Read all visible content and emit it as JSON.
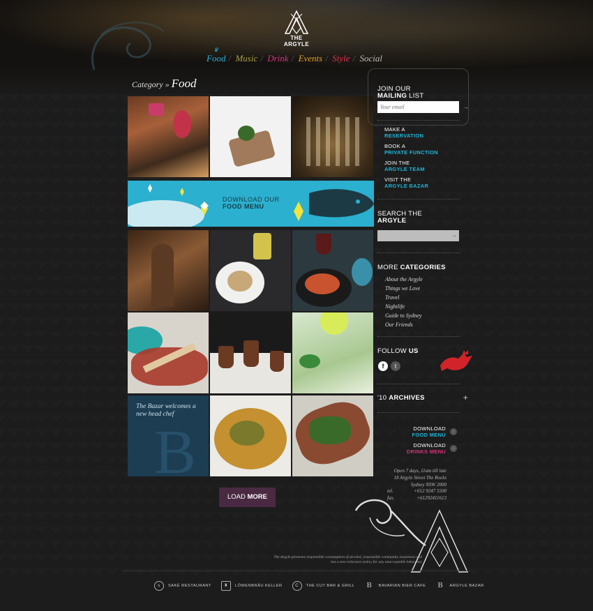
{
  "brand": {
    "name": "THE ARGYLE"
  },
  "nav": [
    {
      "label": "Food",
      "color": "#20b5d8"
    },
    {
      "label": "Music",
      "color": "#a8a14a"
    },
    {
      "label": "Drink",
      "color": "#d6337e"
    },
    {
      "label": "Events",
      "color": "#e0a02c"
    },
    {
      "label": "Style",
      "color": "#e0324a"
    },
    {
      "label": "Social",
      "color": "#bbbbbb"
    }
  ],
  "breadcrumb": {
    "prefix": "Category »",
    "current": "Food"
  },
  "banner": {
    "line1": "DOWNLOAD OUR",
    "line2": "FOOD MENU"
  },
  "bazar_tile": {
    "text": "The Bazar welcomes a new head chef"
  },
  "load_more": {
    "light": "LOAD",
    "bold": "MORE"
  },
  "mailing": {
    "line1": "JOIN OUR",
    "line2_bold": "MAILING",
    "line2_rest": " LIST",
    "placeholder": "Your email"
  },
  "sidebar_links": [
    {
      "top": "MAKE A",
      "bottom": "RESERVATION"
    },
    {
      "top": "BOOK A",
      "bottom": "PRIVATE FUNCTION"
    },
    {
      "top": "JOIN THE",
      "bottom": "ARGYLE TEAM"
    },
    {
      "top": "VISIT THE",
      "bottom": "ARGYLE BAZAR"
    }
  ],
  "search": {
    "line1": "SEARCH THE",
    "line2": "ARGYLE"
  },
  "more_categories": {
    "light": "MORE",
    "bold": "CATEGORIES",
    "items": [
      "About the Argyle",
      "Things we Love",
      "Travel",
      "Nightlife",
      "Guide to Sydney",
      "Our Friends"
    ]
  },
  "follow": {
    "light": "FOLLOW",
    "bold": "US",
    "facebook": "f",
    "twitter": "t"
  },
  "archives": {
    "light": "'10",
    "bold": "ARCHIVES",
    "toggle": "+"
  },
  "downloads": [
    {
      "top": "DOWNLOAD",
      "bottom": "FOOD MENU",
      "color": "#20b5d8"
    },
    {
      "top": "DOWNLOAD",
      "bottom": "DRINKS MENU",
      "color": "#d6337e"
    }
  ],
  "address": {
    "hours": "Open 7 days, 11am till late",
    "street": "18 Argyle Street The Rocks",
    "city": "Sydney NSW 2000",
    "tel_label": "tel.",
    "tel": "+612 9247 5500",
    "fax_label": "fax.",
    "fax": "+61292411613"
  },
  "disclaimer": "The Argyle promotes responsible consumption of alcohol, responsible community awareness and has a zero tolerance policy for any unacceptable behaviour",
  "footer": [
    {
      "label": "SAKÉ RESTAURANT",
      "icon": "saké"
    },
    {
      "label": "LÖWENBRÄU KELLER",
      "icon": "lion"
    },
    {
      "label": "THE CUT BAR & GRILL",
      "icon": "C"
    },
    {
      "label": "BAVARIAN BIER CAFE",
      "icon": "B"
    },
    {
      "label": "ARGYLE BAZAR",
      "icon": "B"
    }
  ]
}
